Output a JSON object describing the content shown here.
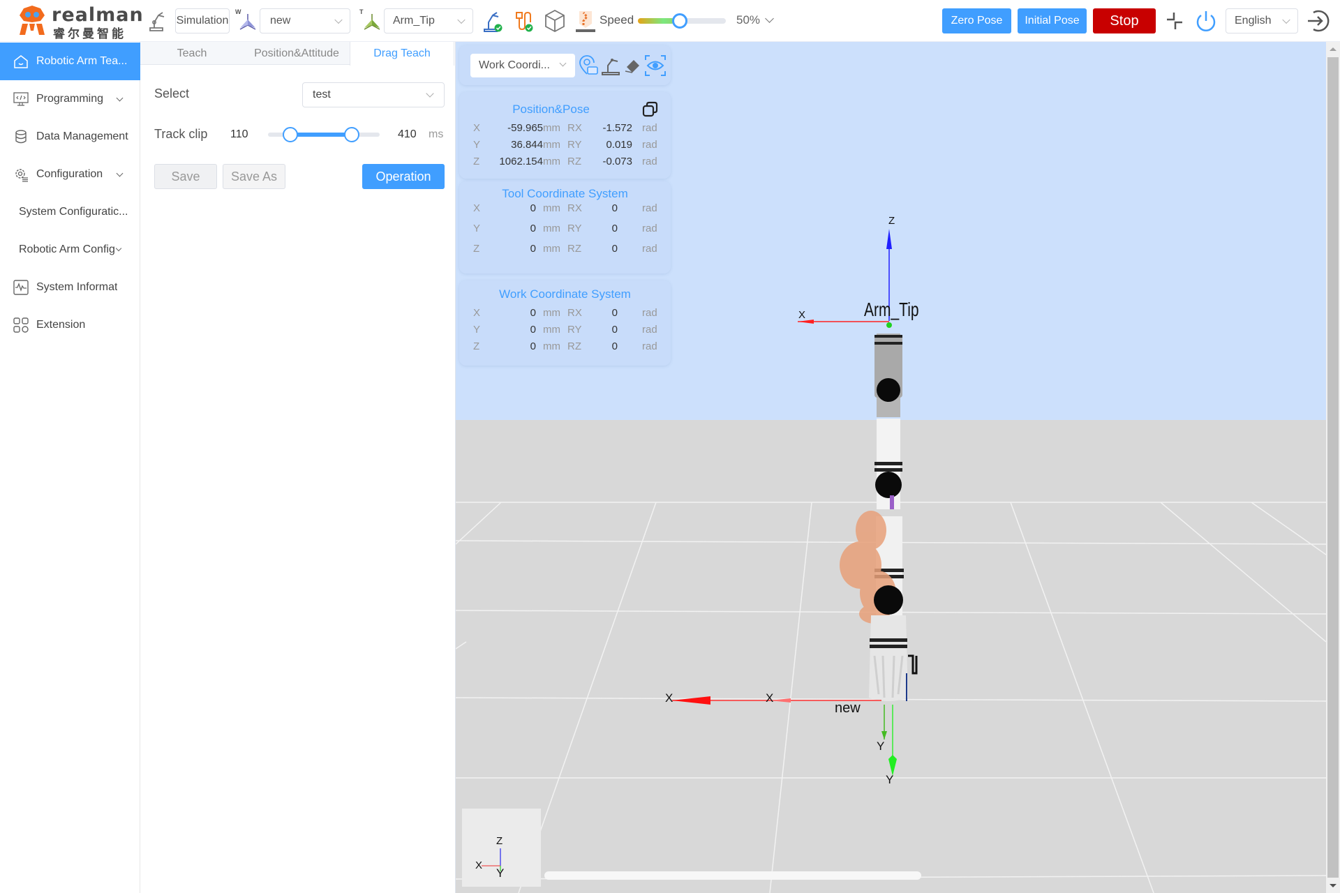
{
  "header": {
    "logo_en": "realman",
    "logo_cn": "睿尔曼智能",
    "mode_label": "Simulation",
    "work_frame_prefix": "W",
    "work_frame_value": "new",
    "tool_frame_prefix": "T",
    "tool_frame_value": "Arm_Tip",
    "speed_label": "Speed",
    "speed_percent": 50,
    "speed_value_text": "50%",
    "zero_pose_label": "Zero Pose",
    "initial_pose_label": "Initial Pose",
    "stop_label": "Stop",
    "language_value": "English",
    "colors": {
      "accent": "#409eff",
      "stop": "#c80000",
      "logo": "#f26b1d"
    }
  },
  "sidebar": {
    "items": [
      {
        "label": "Robotic Arm Tea...",
        "icon": "home-icon",
        "active": true
      },
      {
        "label": "Programming",
        "icon": "code-monitor-icon",
        "expandable": true
      },
      {
        "label": "Data Management",
        "icon": "database-icon"
      },
      {
        "label": "Configuration",
        "icon": "gear-list-icon",
        "expandable": true
      },
      {
        "label": "System Configuratic...",
        "sub": true
      },
      {
        "label": "Robotic Arm Config",
        "sub": true,
        "expandable": true
      },
      {
        "label": "System Informat",
        "icon": "pulse-icon"
      },
      {
        "label": "Extension",
        "icon": "grid-icon"
      }
    ]
  },
  "teach_panel": {
    "tabs": [
      {
        "label": "Teach",
        "active": false
      },
      {
        "label": "Position&Attitude",
        "active": false
      },
      {
        "label": "Drag Teach",
        "active": true
      }
    ],
    "select_label": "Select",
    "select_value": "test",
    "track_clip_label": "Track clip",
    "track_clip_min": 110,
    "track_clip_max": 410,
    "track_clip_low_fraction": 0.2,
    "track_clip_high_fraction": 0.75,
    "track_clip_unit": "ms",
    "save_label": "Save",
    "save_as_label": "Save As",
    "operation_label": "Operation"
  },
  "viewport": {
    "coord_select_value": "Work Coordi...",
    "position_pose": {
      "title": "Position&Pose",
      "rows": [
        {
          "axis": "X",
          "value": "-59.965",
          "unit": "mm",
          "raxis": "RX",
          "rvalue": "-1.572",
          "runit": "rad"
        },
        {
          "axis": "Y",
          "value": "36.844",
          "unit": "mm",
          "raxis": "RY",
          "rvalue": "0.019",
          "runit": "rad"
        },
        {
          "axis": "Z",
          "value": "1062.154",
          "unit": "mm",
          "raxis": "RZ",
          "rvalue": "-0.073",
          "runit": "rad"
        }
      ]
    },
    "tool_cs": {
      "title": "Tool Coordinate System",
      "rows": [
        {
          "axis": "X",
          "value": "0",
          "unit": "mm",
          "raxis": "RX",
          "rvalue": "0",
          "runit": "rad"
        },
        {
          "axis": "Y",
          "value": "0",
          "unit": "mm",
          "raxis": "RY",
          "rvalue": "0",
          "runit": "rad"
        },
        {
          "axis": "Z",
          "value": "0",
          "unit": "mm",
          "raxis": "RZ",
          "rvalue": "0",
          "runit": "rad"
        }
      ]
    },
    "work_cs": {
      "title": "Work Coordinate System",
      "rows": [
        {
          "axis": "X",
          "value": "0",
          "unit": "mm",
          "raxis": "RX",
          "rvalue": "0",
          "runit": "rad"
        },
        {
          "axis": "Y",
          "value": "0",
          "unit": "mm",
          "raxis": "RY",
          "rvalue": "0",
          "runit": "rad"
        },
        {
          "axis": "Z",
          "value": "0",
          "unit": "mm",
          "raxis": "RZ",
          "rvalue": "0",
          "runit": "rad"
        }
      ]
    },
    "scene_labels": {
      "tip_frame": "Arm_Tip",
      "base_frame": "new",
      "x": "X",
      "y": "Y",
      "z": "Z"
    }
  }
}
